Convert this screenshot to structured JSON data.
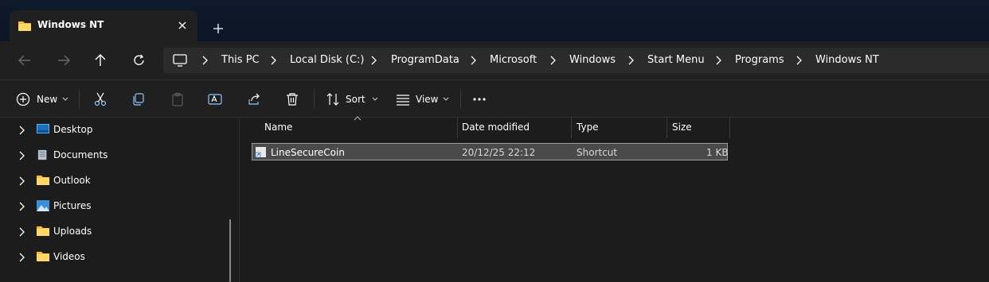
{
  "tab": {
    "title": "Windows NT"
  },
  "breadcrumbs": [
    "This PC",
    "Local Disk (C:)",
    "ProgramData",
    "Microsoft",
    "Windows",
    "Start Menu",
    "Programs",
    "Windows NT"
  ],
  "toolbar": {
    "new_label": "New",
    "sort_label": "Sort",
    "view_label": "View"
  },
  "nav_items": [
    {
      "label": "Desktop",
      "icon": "desktop-icon"
    },
    {
      "label": "Documents",
      "icon": "documents-icon"
    },
    {
      "label": "Outlook",
      "icon": "folder-icon"
    },
    {
      "label": "Pictures",
      "icon": "pictures-icon"
    },
    {
      "label": "Uploads",
      "icon": "folder-icon"
    },
    {
      "label": "Videos",
      "icon": "folder-icon"
    }
  ],
  "columns": {
    "name": "Name",
    "date": "Date modified",
    "type": "Type",
    "size": "Size"
  },
  "files": [
    {
      "name": "LineSecureCoin",
      "date": "20/12/25 22:12",
      "type": "Shortcut",
      "size": "1 KB"
    }
  ],
  "colors": {
    "background": "#1c1c1c",
    "selection": "#4a4a4a",
    "folder": "#f3c035"
  }
}
